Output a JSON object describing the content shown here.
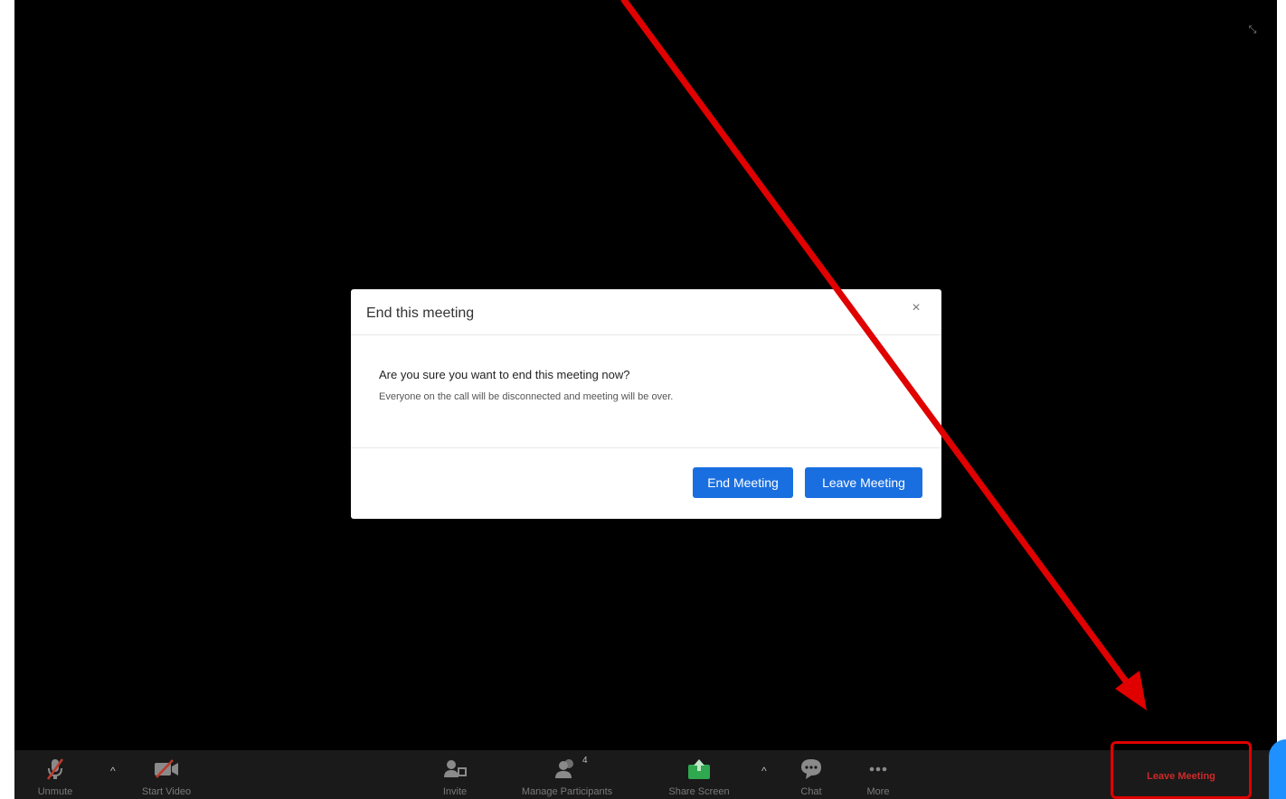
{
  "dialog": {
    "title": "End this meeting",
    "close_glyph": "×",
    "question": "Are you sure you want to end this meeting now?",
    "detail": "Everyone on the call will be disconnected and meeting will be over.",
    "end_label": "End Meeting",
    "leave_label": "Leave Meeting"
  },
  "toolbar": {
    "unmute_label": "Unmute",
    "start_video_label": "Start Video",
    "invite_label": "Invite",
    "participants_label": "Manage Participants",
    "participants_count": "4",
    "share_label": "Share Screen",
    "chat_label": "Chat",
    "more_label": "More",
    "leave_label": "Leave Meeting",
    "caret_glyph": "^"
  },
  "colors": {
    "primary_button": "#1a6fe0",
    "annotation": "#e00000",
    "share_green": "#2fa84f"
  },
  "icons": {
    "fullscreen": "exit-fullscreen-icon",
    "unmute": "microphone-muted-icon",
    "video": "video-off-icon",
    "invite": "invite-icon",
    "participants": "participants-icon",
    "share": "share-screen-icon",
    "chat": "chat-icon",
    "more": "more-icon"
  }
}
